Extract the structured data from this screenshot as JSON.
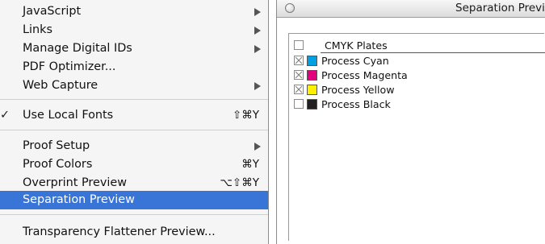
{
  "menu": {
    "items": [
      {
        "label": "JavaScript",
        "submenu": true
      },
      {
        "label": "Links",
        "submenu": true
      },
      {
        "label": "Manage Digital IDs",
        "submenu": true
      },
      {
        "label": "PDF Optimizer..."
      },
      {
        "label": "Web Capture",
        "submenu": true
      },
      {
        "label": "Use Local Fonts",
        "checked": true,
        "shortcut": "⇧⌘Y"
      },
      {
        "label": "Proof Setup",
        "submenu": true
      },
      {
        "label": "Proof Colors",
        "shortcut": "⌘Y"
      },
      {
        "label": "Overprint Preview",
        "shortcut": "⌥⇧⌘Y"
      },
      {
        "label": "Separation Preview",
        "selected": true
      },
      {
        "label": "Transparency Flattener Preview..."
      }
    ],
    "check_glyph": "✓"
  },
  "panel": {
    "title": "Separation Preview",
    "header": "CMYK Plates",
    "plates": [
      {
        "label": "Process Cyan",
        "color": "#00a0e4",
        "checked": true
      },
      {
        "label": "Process Magenta",
        "color": "#e4007c",
        "checked": true
      },
      {
        "label": "Process Yellow",
        "color": "#fff000",
        "checked": true
      },
      {
        "label": "Process Black",
        "color": "#231f20",
        "checked": false
      }
    ]
  },
  "colors": {
    "selection": "#3875d7",
    "menu_background": "#f5f5f5"
  }
}
